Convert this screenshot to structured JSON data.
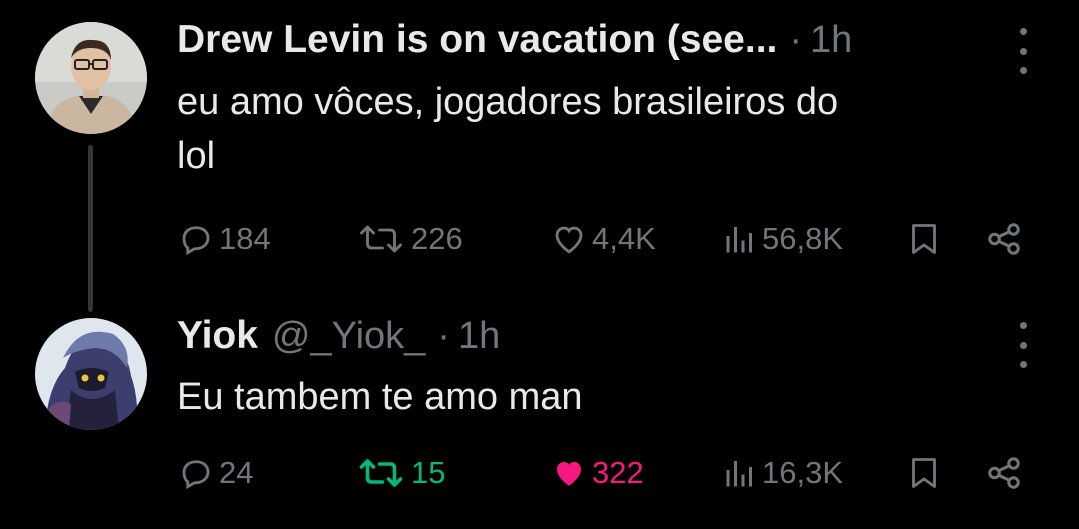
{
  "colors": {
    "background": "#000000",
    "text": "#e7e9ea",
    "muted": "#71767b",
    "retweeted": "#00ba7c",
    "liked": "#f91880",
    "thread_line": "#333639"
  },
  "tweets": [
    {
      "display_name": "Drew Levin is on vacation (see...",
      "handle": "",
      "separator": "·",
      "time": "1h",
      "text": "eu amo vôces, jogadores brasileiros do\nlol",
      "avatar_icon": "person-photo-avatar",
      "more_icon": "more-vertical-icon",
      "actions": {
        "replies": "184",
        "retweets": "226",
        "likes": "4,4K",
        "views": "56,8K",
        "retweeted": false,
        "liked": false
      }
    },
    {
      "display_name": "Yiok",
      "handle": "@_Yiok_",
      "separator": "·",
      "time": "1h",
      "text": "Eu tambem te amo man",
      "avatar_icon": "game-character-avatar",
      "more_icon": "more-vertical-icon",
      "actions": {
        "replies": "24",
        "retweets": "15",
        "likes": "322",
        "views": "16,3K",
        "retweeted": true,
        "liked": true
      }
    }
  ]
}
